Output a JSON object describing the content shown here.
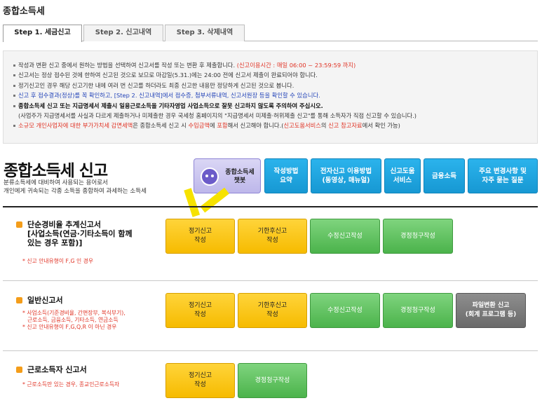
{
  "page": {
    "title": "종합소득세"
  },
  "tabs": [
    {
      "label": "Step 1. 세금신고"
    },
    {
      "label": "Step 2. 신고내역"
    },
    {
      "label": "Step 3. 삭제내역"
    }
  ],
  "notice": {
    "l1": "작성과 변환 신고 중에서 원하는 방법을 선택하여 신고서를 작성 또는 변환 후 제출합니다.",
    "l1_red": "(신고이용시간 : 매일 06:00 ~ 23:59:59 까지)",
    "l2": "신고서는 정상 접수된 것에 한하여 신고된 것으로 보므로 마감일(5.31.)에는 24:00 전에 신고서 제출이 완료되어야 합니다.",
    "l3": "정기신고인 경우 해당 신고기한 내에 여러 번 신고를 하더라도 최종 신고한 내용만 정당하게 신고된 것으로 봅니다.",
    "l4_blue": "신고 후 접수결과(정상)를 꼭 확인하고, [Step 2. 신고내역]에서 접수증, 첨부서류내역, 신고서원장 등을 확인할 수 있습니다.",
    "l5_bold": "종합소득세 신고 또는 지급명세서 제출시 일용근로소득을 기타자영업 사업소득으로 잘못 신고하지 않도록 주의하여 주십시오.",
    "l6": "(사업주가 지급명세서를 사실과 다르게 제출하거나 미제출한 경우 국세청 홈페이지의 \"지급명세서 미제출·허위제출 신고\"를 통해 소득자가 직접 신고할 수 있습니다.)",
    "l7_a": "소규모 개인사업자에 대한 부가가치세 감면세액",
    "l7_b": "은 종합소득세 신고 시",
    "l7_c": "수입금액",
    "l7_d": "에",
    "l7_e": "포함",
    "l7_f": "해서 신고해야 합니다.(",
    "l7_g": "신고도움서비스",
    "l7_h": "의",
    "l7_i": "신고 참고자료",
    "l7_j": "에서 확인 가능)"
  },
  "main": {
    "title": "종합소득세 신고",
    "desc1": "분류소득세에 대비하여 사용되는 용어로서",
    "desc2": "개인에게 귀속되는 각종 소득을 종합하여 과세하는 소득세"
  },
  "chatbot": {
    "line1": "종합소득세",
    "line2": "챗봇"
  },
  "quick": [
    {
      "line1": "작성방법",
      "line2": "요약"
    },
    {
      "line1": "전자신고 이용방법",
      "line2": "(동영상, 매뉴얼)"
    },
    {
      "line1": "신고도움",
      "line2": "서비스"
    },
    {
      "line1": "금융소득",
      "line2": ""
    },
    {
      "line1": "주요 변경사항 및",
      "line2": "자주 묻는 질문"
    }
  ],
  "sections": [
    {
      "title1": "단순경비율 추계신고서",
      "title2": "[사업소득(연금·기타소득이 함께",
      "title3": "있는 경우 포함)]",
      "note1": "* 신고 안내유형이 F,G 인 경우",
      "btn_regular1": "정기신고",
      "btn_regular2": "작성",
      "btn_late1": "기한후신고",
      "btn_late2": "작성",
      "btn_amend": "수정신고작성",
      "btn_claim": "경정청구작성"
    },
    {
      "title1": "일반신고서",
      "note1": "* 사업소득(기준경비율, 간편장부, 복식부기),",
      "note2": "근로소득, 금융소득, 기타소득, 연금소득",
      "note3": "* 신고 안내유형이 F,G,Q,R 이 아닌 경우",
      "btn_regular1": "정기신고",
      "btn_regular2": "작성",
      "btn_late1": "기한후신고",
      "btn_late2": "작성",
      "btn_amend": "수정신고작성",
      "btn_claim": "경정청구작성",
      "btn_file1": "파일변환 신고",
      "btn_file2": "(회계 프로그램 등)"
    },
    {
      "title1": "근로소득자 신고서",
      "note1": "* 근로소득만 있는 경우, 종교인근로소득자",
      "btn_regular1": "정기신고",
      "btn_regular2": "작성",
      "btn_claim": "경정청구작성"
    }
  ],
  "colors": {
    "accent_blue": "#1798d3",
    "yellow": "#f6bb00",
    "green": "#4bb34b",
    "red_text": "#e03325"
  }
}
